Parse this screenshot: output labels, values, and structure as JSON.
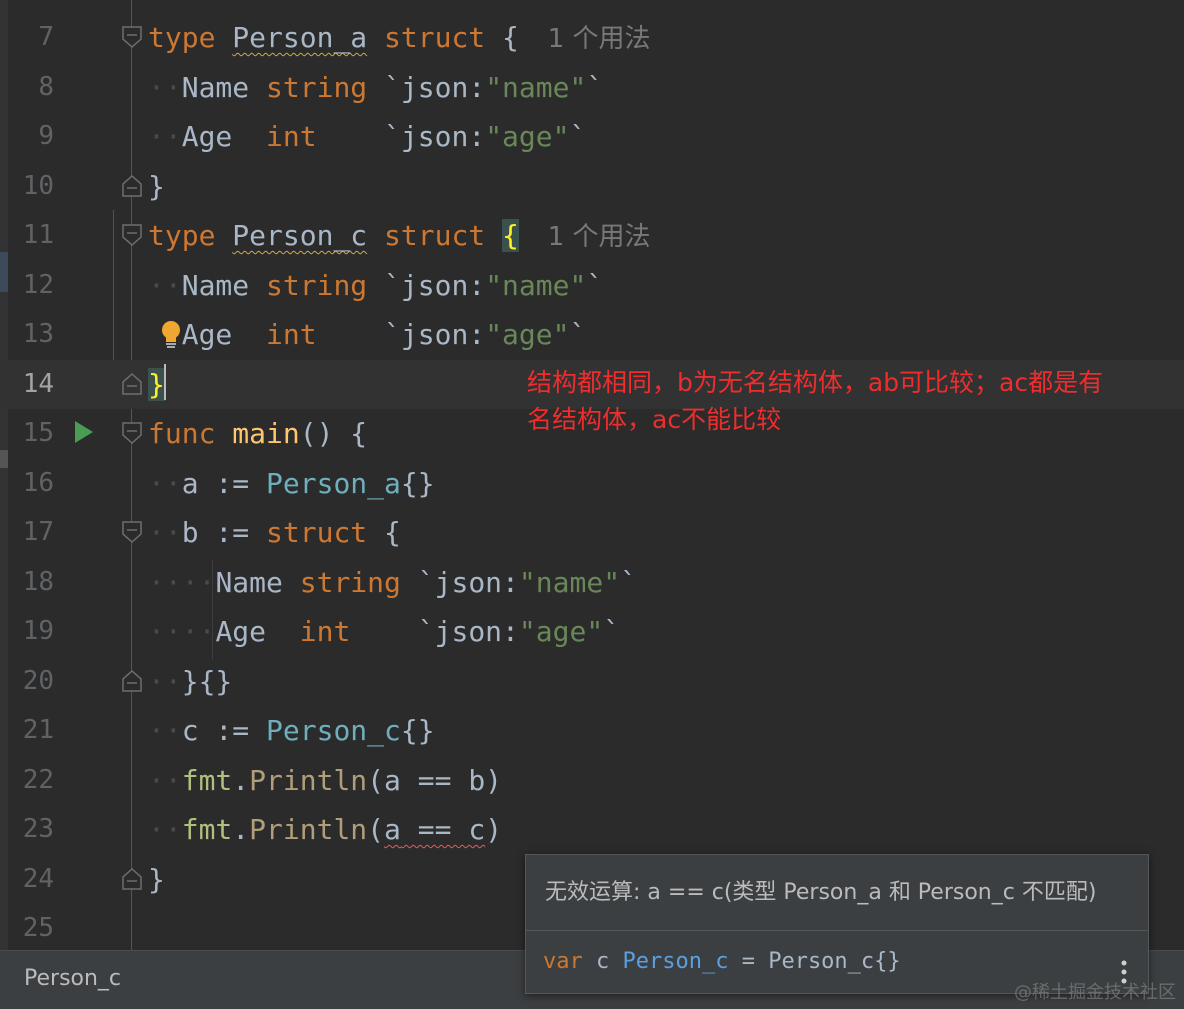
{
  "editor": {
    "lines": [
      {
        "num": "7"
      },
      {
        "num": "8"
      },
      {
        "num": "9"
      },
      {
        "num": "10"
      },
      {
        "num": "11"
      },
      {
        "num": "12"
      },
      {
        "num": "13"
      },
      {
        "num": "14"
      },
      {
        "num": "15"
      },
      {
        "num": "16"
      },
      {
        "num": "17"
      },
      {
        "num": "18"
      },
      {
        "num": "19"
      },
      {
        "num": "20"
      },
      {
        "num": "21"
      },
      {
        "num": "22"
      },
      {
        "num": "23"
      },
      {
        "num": "24"
      },
      {
        "num": "25"
      }
    ],
    "current_line": "14",
    "usage_hint_a": "1 个用法",
    "usage_hint_c": "1 个用法",
    "code": {
      "kw_type": "type",
      "kw_struct": "struct",
      "kw_func": "func",
      "name_person_a": "Person_a",
      "name_person_c": "Person_c",
      "field_name": "Name",
      "field_age": "Age",
      "type_string": "string",
      "type_int": "int",
      "tag_json": "`json:",
      "tag_name": "\"name\"",
      "tag_age": "\"age\"",
      "backtick": "`",
      "open_brace": "{",
      "close_brace": "}",
      "fn_main": "main",
      "parens_open": "() {",
      "var_a": "a",
      "var_b": "b",
      "var_c": "c",
      "assign": " := ",
      "empty_lit": "{}",
      "close_lit": "}{}",
      "pkg_fmt": "fmt",
      "fn_println": "Println",
      "expr_ab": "(a == b)",
      "expr_paren": "(",
      "expr_a": "a",
      "expr_eq_c": " == c",
      "expr_close": ")"
    }
  },
  "annotation": {
    "line1": "结构都相同，b为无名结构体，ab可比较；ac都是有",
    "line2": "名结构体，ac不能比较"
  },
  "popup": {
    "message": "无效运算: a == c(类型 Person_a 和 Person_c 不匹配)",
    "decl_kw": "var",
    "decl_name": " c ",
    "decl_type": "Person_c",
    "decl_rest": " = Person_c{}"
  },
  "statusbar": {
    "breadcrumb": "Person_c"
  },
  "watermark": "@稀土掘金技术社区",
  "colors": {
    "background": "#2b2b2b",
    "keyword": "#cc7832",
    "string": "#6a8759",
    "annotation": "#ef2d2d"
  }
}
